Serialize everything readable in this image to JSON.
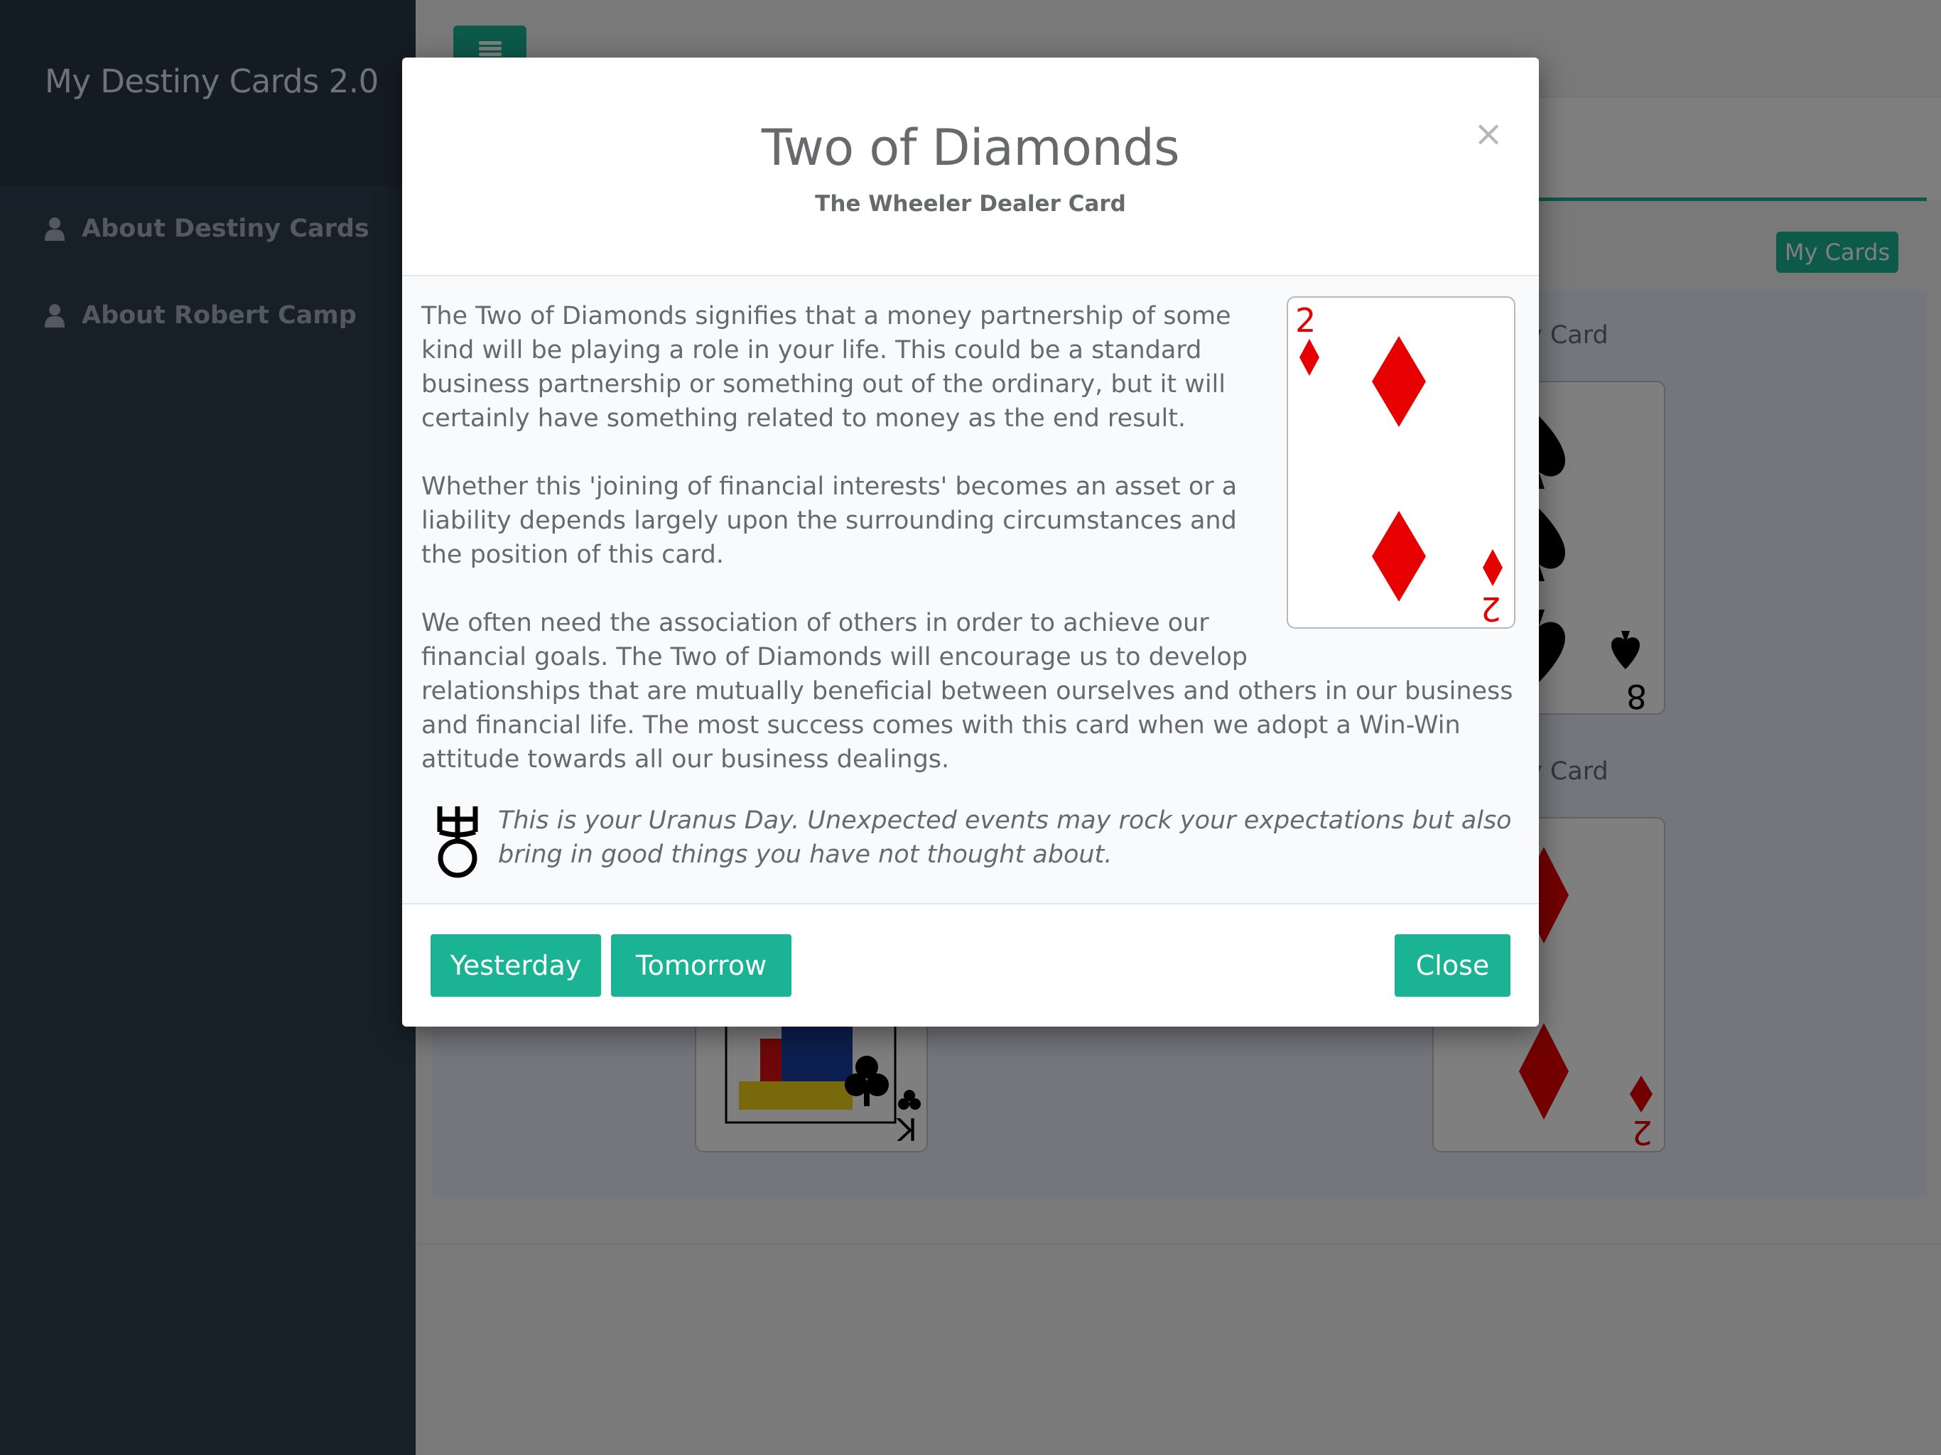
{
  "app": {
    "title": "My Destiny Cards 2.0"
  },
  "sidebar": {
    "items": [
      {
        "label": "About Destiny Cards",
        "icon": "user-icon"
      },
      {
        "label": "About Robert Camp",
        "icon": "user-icon"
      }
    ]
  },
  "page": {
    "my_cards_button": "My Cards",
    "label_right_top_partial": "y Card",
    "label_right_bottom_partial": "y Card",
    "cards": [
      {
        "rank": "8",
        "suit": "spades",
        "suit_symbol": "♠",
        "color": "#000000"
      },
      {
        "rank": "K",
        "suit": "clubs",
        "suit_symbol": "♣",
        "color": "#000000"
      },
      {
        "rank": "2",
        "suit": "diamonds",
        "suit_symbol": "♦",
        "color": "#e60000"
      }
    ]
  },
  "modal": {
    "title": "Two of Diamonds",
    "subtitle": "The Wheeler Dealer Card",
    "close_x": "×",
    "card": {
      "rank": "2",
      "suit_symbol": "♦",
      "color": "#e60000"
    },
    "paragraphs": [
      "The Two of Diamonds signifies that a money partnership of some kind will be playing a role in your life. This could be a standard business partnership or something out of the ordinary, but it will certainly have something related to money as the end result.",
      "Whether this 'joining of financial interests' becomes an asset or a liability depends largely upon the surrounding circumstances and the position of this card.",
      "We often need the association of others in order to achieve our financial goals. The Two of Diamonds will encourage us to develop relationships that are mutually beneficial between ourselves and others in our business and financial life. The most success comes with this card when we adopt a Win-Win attitude towards all our business dealings."
    ],
    "planet": {
      "icon": "uranus-icon",
      "text": "This is your Uranus Day. Unexpected events may rock your expectations but also bring in good things you have not thought about."
    },
    "buttons": {
      "yesterday": "Yesterday",
      "tomorrow": "Tomorrow",
      "close": "Close"
    }
  },
  "colors": {
    "accent": "#1ab394",
    "sidebar": "#2f4050",
    "diamond_red": "#e60000"
  }
}
